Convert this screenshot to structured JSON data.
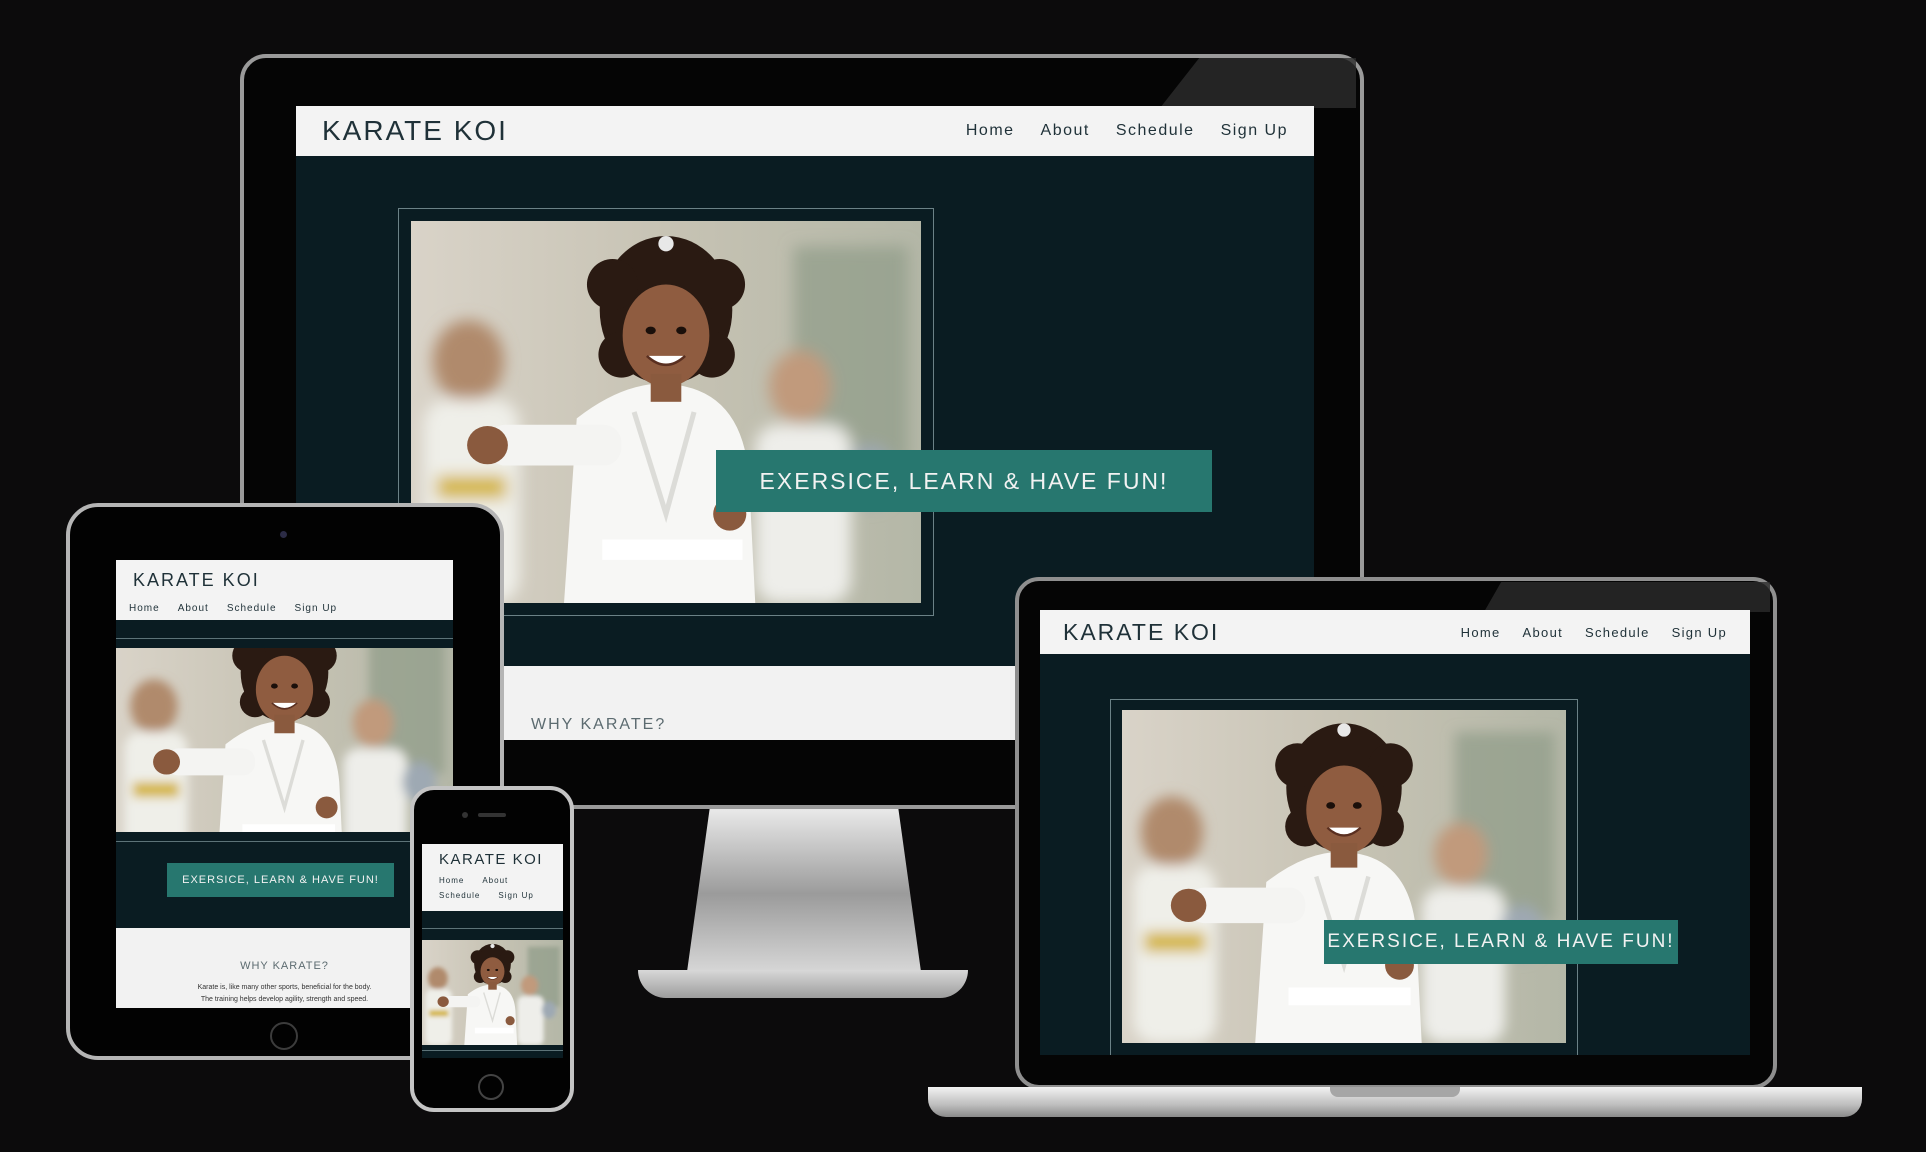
{
  "site": {
    "brand": "KARATE KOI",
    "nav": [
      "Home",
      "About",
      "Schedule",
      "Sign Up"
    ],
    "hero_cta": "EXERSICE, LEARN & HAVE FUN!",
    "why_heading": "WHY KARATE?",
    "why_text_1": "Karate is, like many other sports, beneficial for the body.",
    "why_text_2": "The training helps develop agility, strength and speed."
  },
  "colors": {
    "page_background": "#0c0b0c",
    "site_dark": "#0a1c22",
    "nav_background": "#f3f3f3",
    "cta_teal": "#27776f",
    "text_dark": "#1f3138"
  }
}
